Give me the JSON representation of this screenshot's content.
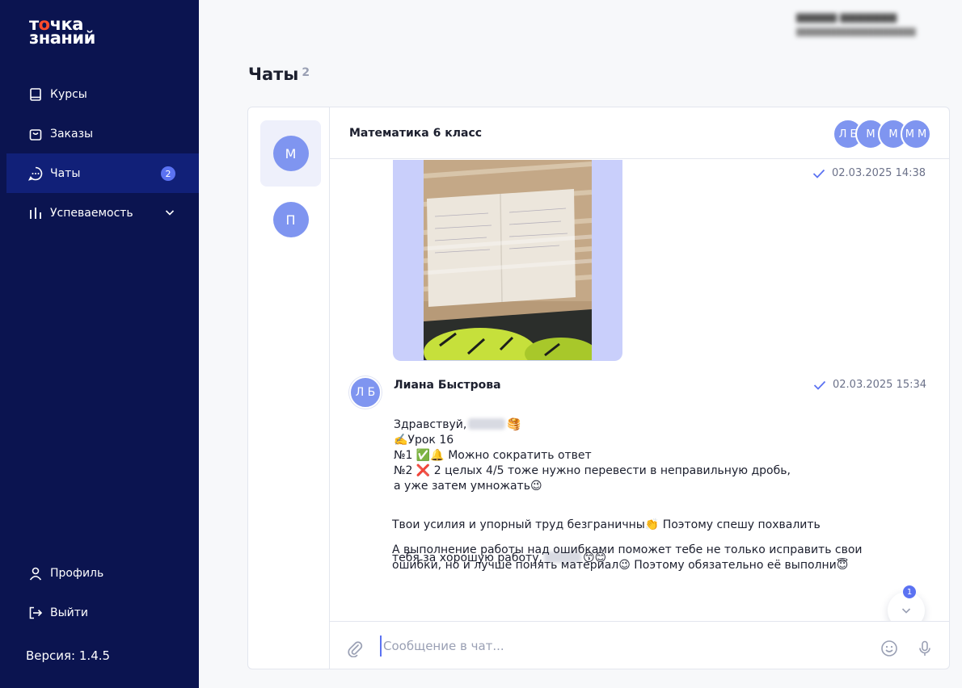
{
  "app": {
    "logo_line1": "точка",
    "logo_line2": "знаний",
    "version": "Версия: 1.4.5"
  },
  "sidebar": {
    "items": [
      {
        "label": "Курсы",
        "icon": "book-icon"
      },
      {
        "label": "Заказы",
        "icon": "shopping-bag-icon"
      },
      {
        "label": "Чаты",
        "icon": "chat-bubble-icon",
        "badge": "2",
        "active": true
      },
      {
        "label": "Успеваемость",
        "icon": "bar-chart-icon",
        "expandable": true
      }
    ],
    "bottom": [
      {
        "label": "Профиль",
        "icon": "user-icon"
      },
      {
        "label": "Выйти",
        "icon": "logout-icon"
      }
    ]
  },
  "page": {
    "title": "Чаты",
    "count": "2"
  },
  "chat_list": [
    {
      "initial": "М",
      "active": true
    },
    {
      "initial": "П",
      "active": false
    }
  ],
  "chat": {
    "title": "Математика 6 класс",
    "participants": [
      "Л Б",
      "М",
      "М",
      "М М"
    ],
    "messages": {
      "image_time": "02.03.2025 14:38",
      "sender_initials": "Л Б",
      "sender_name": "Лиана Быстрова",
      "time": "02.03.2025 15:34",
      "greeting_prefix": "Здравствуй,",
      "greeting_emoji": "🥞",
      "block1": "✍️Урок 16\n№1 ✅🔔 Можно сократить ответ\n№2 ❌ 2 целых 4/5 тоже нужно перевести в неправильную дробь,\nа уже затем умножать😉",
      "block2_line1": "Твои усилия и упорный труд безграничны👏 Поэтому спешу похвалить",
      "block2_line2_prefix": "тебя за хорошую работу,",
      "block2_line2_emoji": "😙😊",
      "block3": "А выполнение работы над ошибками поможет тебе не только исправить свои\nошибки, но и лучше понять материал😉 Поэтому обязательно её выполни😇"
    },
    "unread_badge": "1",
    "composer": {
      "placeholder": "Сообщение в чат..."
    }
  },
  "colors": {
    "sidebar_bg": "#0b1450",
    "sidebar_active": "#112078",
    "accent": "#5b72f2",
    "avatar": "#7f95f0",
    "logo_accent": "#ff4b2b"
  }
}
